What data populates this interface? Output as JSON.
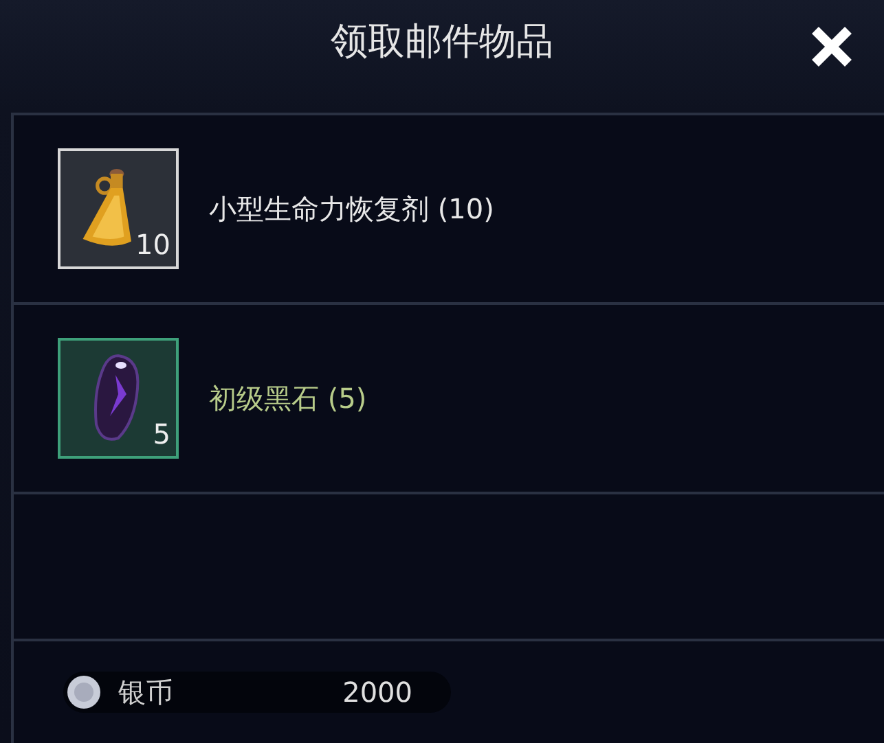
{
  "window": {
    "title": "领取邮件物品"
  },
  "items": [
    {
      "name": "小型生命力恢复剂 (10)",
      "count": "10",
      "kind": "potion",
      "color": "#d8d8d8"
    },
    {
      "name": "初级黑石 (5)",
      "count": "5",
      "kind": "stone",
      "color": "#3ea07a"
    }
  ],
  "currency": {
    "name": "银币",
    "amount": "2000"
  }
}
